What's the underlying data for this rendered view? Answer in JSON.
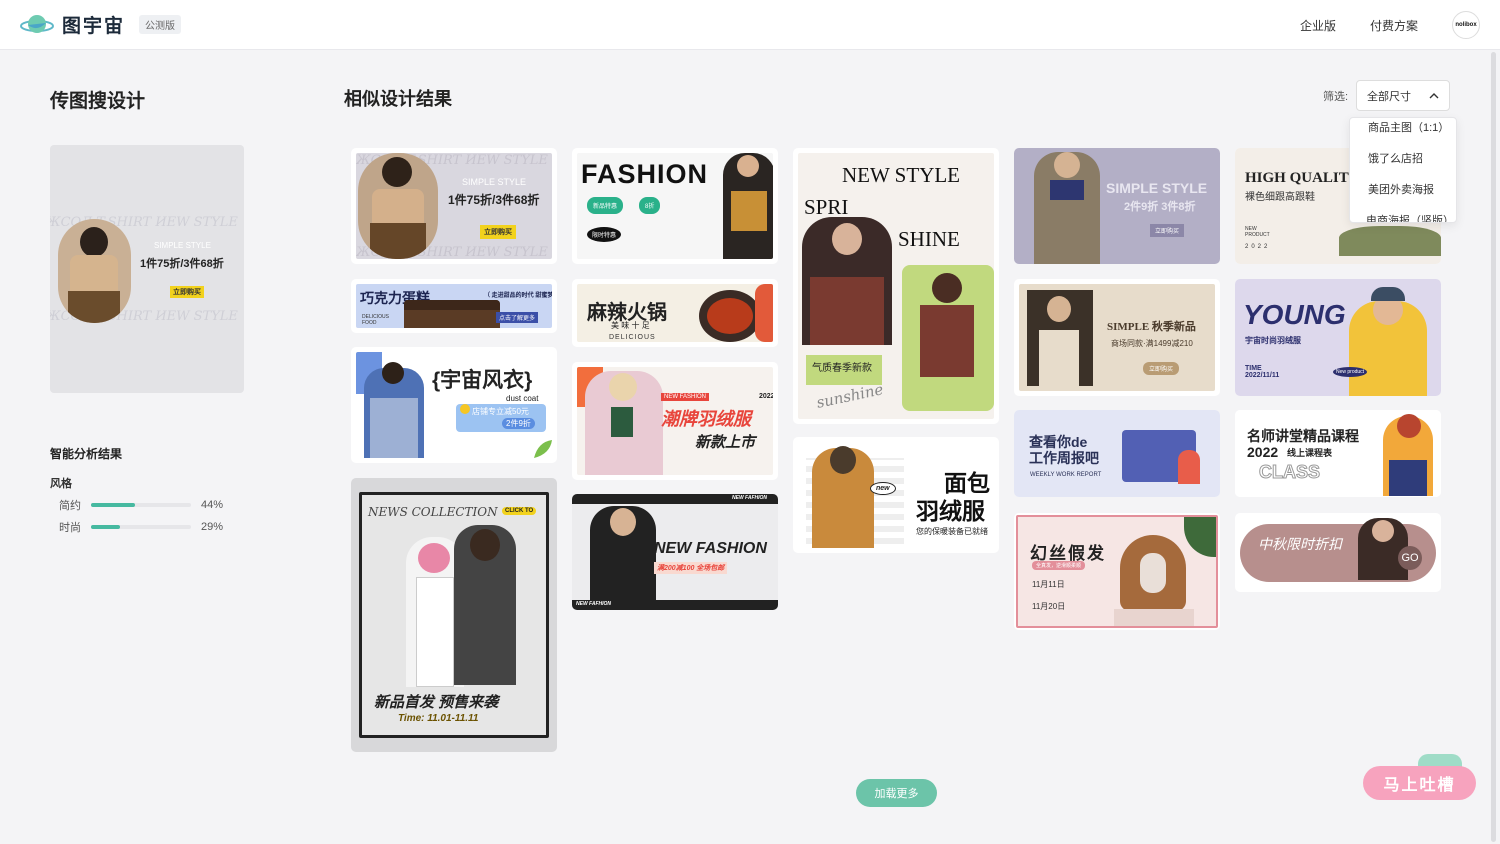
{
  "header": {
    "logo_text": "图宇宙",
    "beta_badge": "公测版",
    "nav": [
      "企业版",
      "付费方案"
    ],
    "avatar_text": "nolibox"
  },
  "left": {
    "title": "传图搜设计",
    "upload_preview": {
      "bg_text": "ЖСОЛ T-SHIRT ИЕW STYLE",
      "simple_style": "SIMPLE STYLE",
      "offer": "1件75折/3件68折",
      "buy": "立即购买"
    },
    "analysis_title": "智能分析结果",
    "style_label": "风格",
    "stats": [
      {
        "name": "简约",
        "value": 0.44,
        "text": "44%"
      },
      {
        "name": "时尚",
        "value": 0.29,
        "text": "29%"
      }
    ]
  },
  "right": {
    "title": "相似设计结果",
    "filter_label": "筛选:",
    "filter_value": "全部尺寸",
    "filter_options": [
      "商品主图（1:1）",
      "饿了么店招",
      "美团外卖海报",
      "电商海报（竖版）"
    ]
  },
  "cards": {
    "c1": {
      "simple": "SIMPLE STYLE",
      "offer": "1件75折/3件68折",
      "buy": "立即购买",
      "bg": "ЖСОЛ T-SHIRT ИЕW STYLE"
    },
    "c2": {
      "title": "巧克力蛋糕",
      "tag": "（ 走进甜品的时代 甜蜜梦幻 ）",
      "btn": "点击了解更多",
      "small": "DELICIOUS FOOD"
    },
    "c3": {
      "title": "{宇宙风衣}",
      "sub": "dust coat",
      "offer1": "店铺专立减50元",
      "offer2": "2件9折"
    },
    "c4": {
      "title": "NEWS COLLECTION",
      "click": "CLICK TO",
      "slogan": "新品首发 预售来袭",
      "time": "Time: 11.01-11.11"
    },
    "c5": {
      "title": "FASHION",
      "b1": "新品特惠",
      "b2": "8折",
      "b3": "限时特惠"
    },
    "c6": {
      "title": "麻辣火锅",
      "sub": "美 味 十 足",
      "en": "DELICIOUS"
    },
    "c7": {
      "tag": "NEW FASHION",
      "year": "2022",
      "title": "潮牌羽绒服",
      "sub": "新款上市"
    },
    "c8": {
      "top": "NEW FAFHION",
      "title": "NEW FASHION",
      "offer": "满200减100 全场包邮",
      "bottom": "NEW FAFHION"
    },
    "c9": {
      "l1": "NEW STYLE",
      "l2": "SPRI",
      "l3": "SHINE",
      "cn": "气质春季新款",
      "script": "sunshine"
    },
    "c10": {
      "t1": "面包",
      "t2": "羽绒服",
      "sub": "您的保暖装备已就绪",
      "badge": "new"
    },
    "c11": {
      "title": "SIMPLE STYLE",
      "offer": "2件9折 3件8折",
      "btn": "立即购买"
    },
    "c12": {
      "title": "SIMPLE 秋季新品",
      "sub": "商场同款·满1499减210",
      "btn": "立即购买"
    },
    "c13": {
      "title1": "查看你de",
      "title2": "工作周报吧",
      "en": "WEEKLY WORK REPORT"
    },
    "c14": {
      "title": "幻丝假发",
      "tag": "全真发，逆滑顺柔顺",
      "d1": "11月11日",
      "d2": "11月20日"
    },
    "c15": {
      "title": "HIGH QUALIT",
      "sub": "裸色细跟高跟鞋",
      "np": "NEW PRODUCT",
      "year": "2022"
    },
    "c16": {
      "title": "YOUNG",
      "sub": "宇宙时尚羽绒服",
      "time": "TIME 2022/11/11",
      "badge": "New product"
    },
    "c17": {
      "t1": "名师讲堂精品课程",
      "t2": "2022",
      "t3": "线上课程表",
      "cls": "CLASS"
    },
    "c18": {
      "title": "中秋限时折扣",
      "go": "GO"
    }
  },
  "load_more": "加载更多",
  "feedback": "马上吐槽",
  "colors": {
    "accent": "#6cc4a9",
    "bar": "#46b9a0",
    "feedback": "#f7a3be"
  }
}
